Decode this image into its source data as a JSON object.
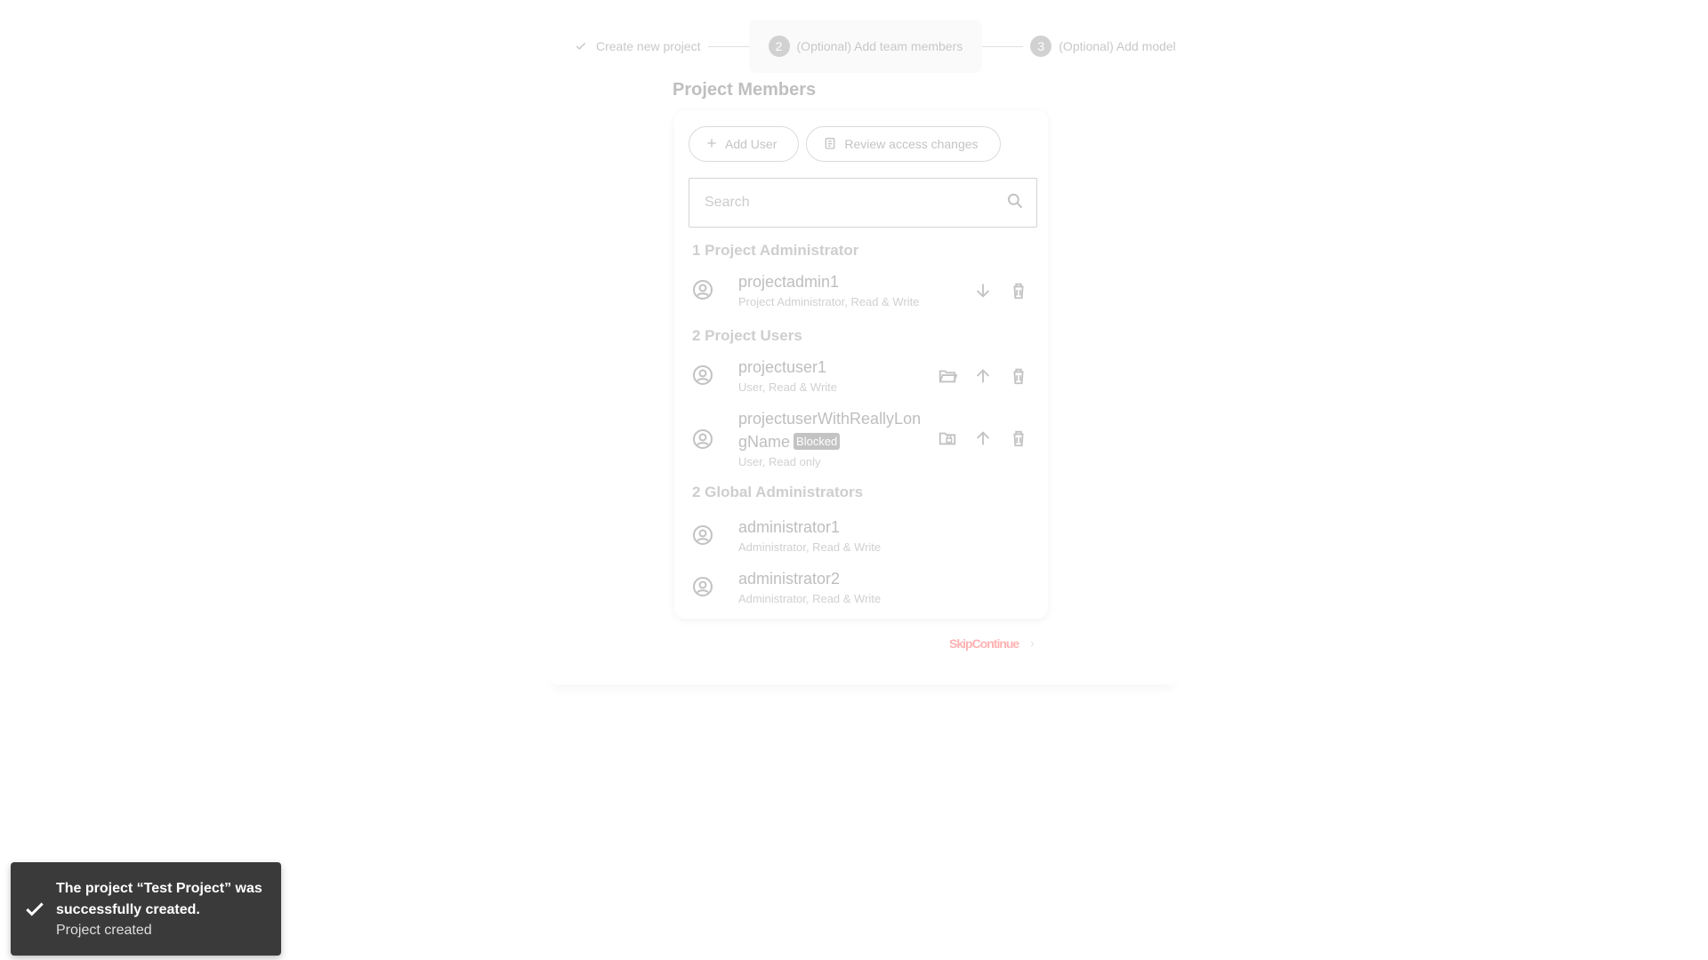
{
  "stepper": {
    "step1": {
      "label": "Create new project",
      "icon": "check-icon"
    },
    "step2": {
      "number": "2",
      "label": "(Optional) Add team members"
    },
    "step3": {
      "number": "3",
      "label": "(Optional) Add model"
    }
  },
  "section_title": "Project Members",
  "buttons": {
    "add_user": "Add User",
    "review_access": "Review access changes"
  },
  "search": {
    "placeholder": "Search",
    "value": ""
  },
  "groups": [
    {
      "title": "1 Project Administrator",
      "members": [
        {
          "name": "projectadmin1",
          "role": "Project Administrator, Read & Write",
          "actions": [
            "arrow-down-icon",
            "delete-icon"
          ]
        }
      ]
    },
    {
      "title": "2 Project Users",
      "members": [
        {
          "name": "projectuser1",
          "role": "User, Read & Write",
          "actions": [
            "folder-open-icon",
            "arrow-up-icon",
            "delete-icon"
          ]
        },
        {
          "name_line1": "projectuserWithReallyLon",
          "name_line2": "gName",
          "badge": "Blocked",
          "role": "User, Read only",
          "actions": [
            "folder-lock-icon",
            "arrow-up-icon",
            "delete-icon"
          ]
        }
      ]
    },
    {
      "title": "2 Global Administrators",
      "members": [
        {
          "name": "administrator1",
          "role": "Administrator, Read & Write"
        },
        {
          "name": "administrator2",
          "role": "Administrator, Read & Write"
        }
      ]
    }
  ],
  "footer": {
    "link": "SkipContinue"
  },
  "toast": {
    "title": "The project “Test Project” was successfully created.",
    "subtitle": "Project created"
  }
}
